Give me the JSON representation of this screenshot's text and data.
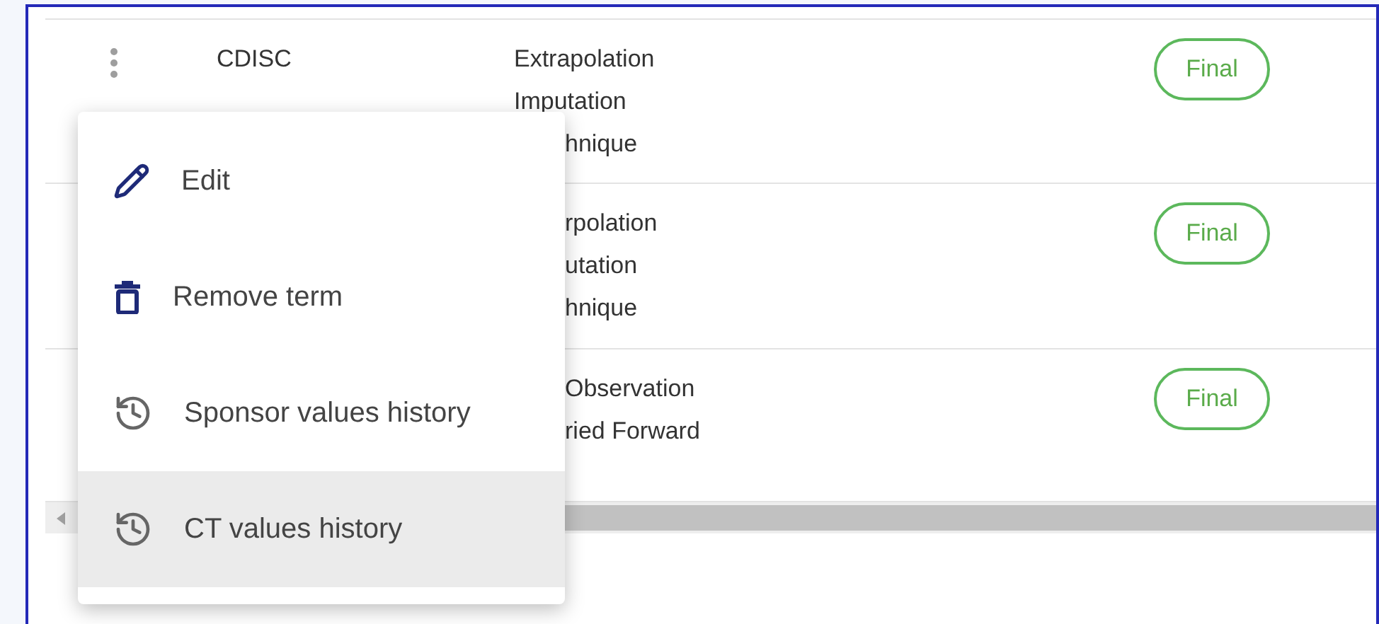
{
  "table": {
    "rows": [
      {
        "source": "CDISC",
        "name_lines": [
          "Extrapolation",
          "Imputation"
        ],
        "name_lines_cut_by_menu": [
          "hnique"
        ],
        "status": "Final"
      },
      {
        "name_lines": [],
        "name_lines_cut_by_menu": [
          "rpolation",
          "utation",
          "hnique"
        ],
        "status": "Final"
      },
      {
        "name_lines": [],
        "name_lines_cut_by_menu": [
          "Observation",
          "ried Forward"
        ],
        "status": "Final"
      }
    ]
  },
  "context_menu": {
    "items": [
      {
        "kind": "edit",
        "label": "Edit",
        "selected": false
      },
      {
        "kind": "delete",
        "label": "Remove term",
        "selected": false
      },
      {
        "kind": "history",
        "label": "Sponsor values history",
        "selected": false
      },
      {
        "kind": "history",
        "label": "CT values history",
        "selected": true
      }
    ]
  }
}
